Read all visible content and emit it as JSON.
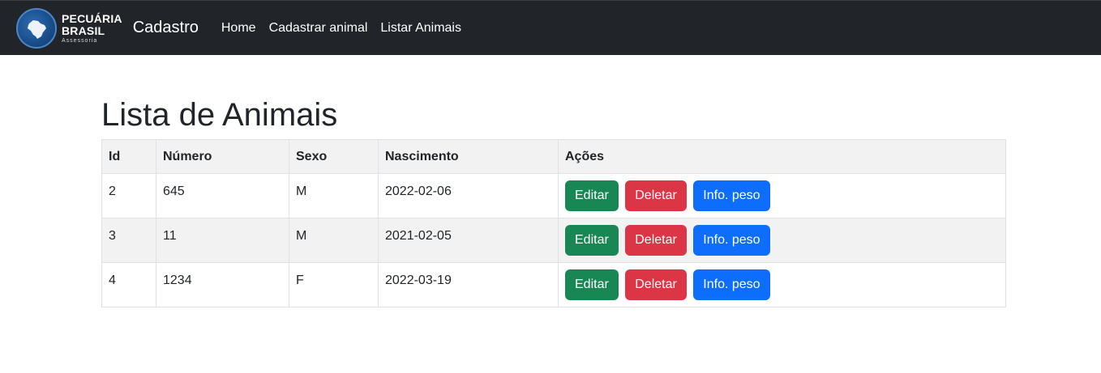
{
  "navbar": {
    "logo": {
      "line1": "PECUÁRIA",
      "line2": "BRASIL",
      "line3": "Assessoria",
      "icon": "brazil-map-icon"
    },
    "title": "Cadastro",
    "links": [
      {
        "label": "Home"
      },
      {
        "label": "Cadastrar animal"
      },
      {
        "label": "Listar Animais"
      }
    ]
  },
  "main": {
    "title": "Lista de Animais",
    "table": {
      "headers": [
        "Id",
        "Número",
        "Sexo",
        "Nascimento",
        "Ações"
      ],
      "rows": [
        {
          "id": "2",
          "numero": "645",
          "sexo": "M",
          "nascimento": "2022-02-06"
        },
        {
          "id": "3",
          "numero": "11",
          "sexo": "M",
          "nascimento": "2021-02-05"
        },
        {
          "id": "4",
          "numero": "1234",
          "sexo": "F",
          "nascimento": "2022-03-19"
        }
      ],
      "actions": {
        "edit": "Editar",
        "delete": "Deletar",
        "info": "Info. peso"
      }
    }
  },
  "colors": {
    "navbar_bg": "#212529",
    "edit": "#198754",
    "delete": "#dc3545",
    "info": "#0d6efd",
    "stripe": "#f2f2f2"
  }
}
